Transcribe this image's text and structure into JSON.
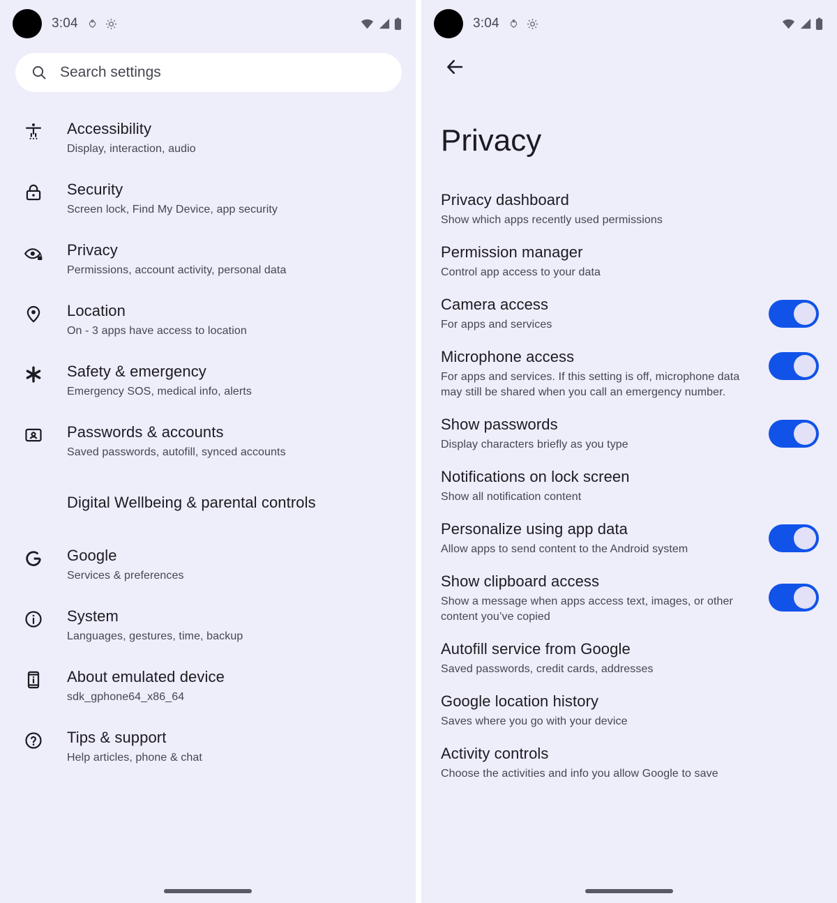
{
  "status_bar": {
    "time": "3:04",
    "mini_icons": [
      "alarm-icon",
      "gear-icon"
    ],
    "right_icons": [
      "wifi-icon",
      "cellular-signal-icon",
      "battery-icon"
    ]
  },
  "colors": {
    "background": "#eeedfa",
    "search_field": "#ffffff",
    "primary_text": "#1b1b21",
    "secondary_text": "#45464f",
    "toggle_on_track": "#1153e8",
    "toggle_thumb": "#e2e1f8",
    "gesture_bar": "#5a5a64",
    "camera_cutout": "#000000"
  },
  "left_screen": {
    "search": {
      "placeholder": "Search settings",
      "icon": "search-icon"
    },
    "items": [
      {
        "icon": "accessibility-icon",
        "title": "Accessibility",
        "subtitle": "Display, interaction, audio"
      },
      {
        "icon": "lock-icon",
        "title": "Security",
        "subtitle": "Screen lock, Find My Device, app security"
      },
      {
        "icon": "eye-lock-icon",
        "title": "Privacy",
        "subtitle": "Permissions, account activity, personal data"
      },
      {
        "icon": "location-pin-icon",
        "title": "Location",
        "subtitle": "On - 3 apps have access to location"
      },
      {
        "icon": "asterisk-icon",
        "title": "Safety & emergency",
        "subtitle": "Emergency SOS, medical info, alerts"
      },
      {
        "icon": "account-card-icon",
        "title": "Passwords & accounts",
        "subtitle": "Saved passwords, autofill, synced accounts"
      },
      {
        "icon": "",
        "title": "Digital Wellbeing & parental controls",
        "subtitle": ""
      },
      {
        "icon": "google-g-icon",
        "title": "Google",
        "subtitle": "Services & preferences"
      },
      {
        "icon": "info-circle-icon",
        "title": "System",
        "subtitle": "Languages, gestures, time, backup"
      },
      {
        "icon": "phone-info-icon",
        "title": "About emulated device",
        "subtitle": "sdk_gphone64_x86_64"
      },
      {
        "icon": "question-circle-icon",
        "title": "Tips & support",
        "subtitle": "Help articles, phone & chat"
      }
    ]
  },
  "right_screen": {
    "back_icon": "arrow-back-icon",
    "title": "Privacy",
    "items": [
      {
        "title": "Privacy dashboard",
        "subtitle": "Show which apps recently used permissions",
        "toggle": null
      },
      {
        "title": "Permission manager",
        "subtitle": "Control app access to your data",
        "toggle": null
      },
      {
        "title": "Camera access",
        "subtitle": "For apps and services",
        "toggle": "on"
      },
      {
        "title": "Microphone access",
        "subtitle": "For apps and services. If this setting is off, microphone data may still be shared when you call an emergency number.",
        "toggle": "on"
      },
      {
        "title": "Show passwords",
        "subtitle": "Display characters briefly as you type",
        "toggle": "on"
      },
      {
        "title": "Notifications on lock screen",
        "subtitle": "Show all notification content",
        "toggle": null
      },
      {
        "title": "Personalize using app data",
        "subtitle": "Allow apps to send content to the Android system",
        "toggle": "on"
      },
      {
        "title": "Show clipboard access",
        "subtitle": "Show a message when apps access text, images, or other content you’ve copied",
        "toggle": "on"
      },
      {
        "title": "Autofill service from Google",
        "subtitle": "Saved passwords, credit cards, addresses",
        "toggle": null
      },
      {
        "title": "Google location history",
        "subtitle": "Saves where you go with your device",
        "toggle": null
      },
      {
        "title": "Activity controls",
        "subtitle": "Choose the activities and info you allow Google to save",
        "toggle": null
      }
    ]
  }
}
